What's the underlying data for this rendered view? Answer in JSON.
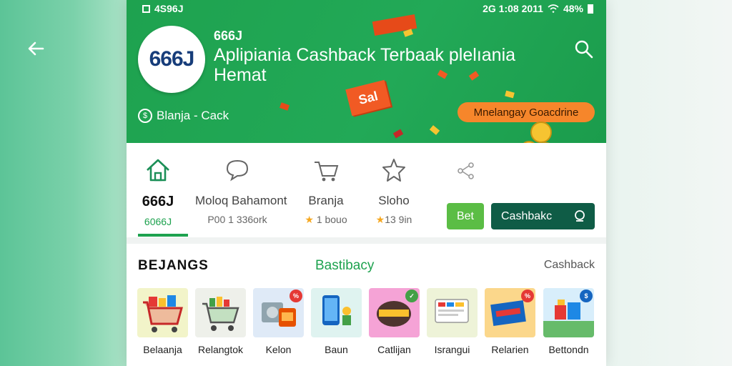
{
  "status_bar": {
    "left": "4S96J",
    "right": "2G 1:08 2011",
    "battery": "48%"
  },
  "header": {
    "logo_text": "666J",
    "brand": "666J",
    "headline": "Aplipiania Cashback Terbaak plelıania Hemat",
    "tagline": "Blanja - Cack",
    "promo_pill": "Mnelangay Goacdrine",
    "sale_tag": "Sal"
  },
  "nav": {
    "items": [
      {
        "label": "666J",
        "sub": "6066J",
        "icon": "home-icon"
      },
      {
        "label": "Moloq Bahamont",
        "sub": "P00 1 336ork",
        "icon": "chat-icon"
      },
      {
        "label": "Branja",
        "sub": "1 bouo",
        "icon": "cart-icon"
      },
      {
        "label": "Sloho",
        "sub": "13 9in",
        "icon": "star-icon"
      }
    ],
    "share_icon": "share-icon",
    "small_button": "Bet",
    "cashback_button": "Cashbakc"
  },
  "section": {
    "title_left": "BEJANGS",
    "title_mid": "Bastibacy",
    "title_right": "Cashback"
  },
  "cards": [
    {
      "caption": "Belaanja",
      "color": "#f2f4c9"
    },
    {
      "caption": "Relangtok",
      "color": "#eef0ea"
    },
    {
      "caption": "Kelon",
      "color": "#dfeaf7"
    },
    {
      "caption": "Baun",
      "color": "#dff3f0"
    },
    {
      "caption": "Catlijan",
      "color": "#f5a3d6"
    },
    {
      "caption": "Israngui",
      "color": "#eef3d8"
    },
    {
      "caption": "Relarien",
      "color": "#fbd78b"
    },
    {
      "caption": "Bettondn",
      "color": "#d8eefb"
    }
  ]
}
